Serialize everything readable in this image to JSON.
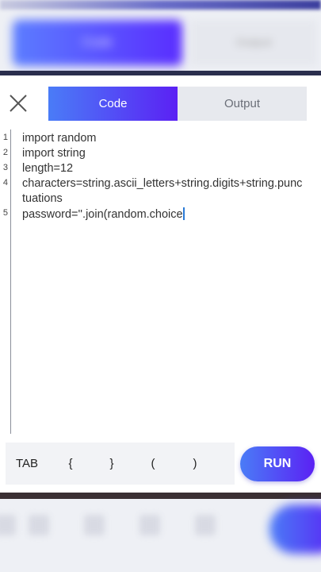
{
  "background": {
    "top_tab_code": "Code",
    "top_tab_output": "Output"
  },
  "header": {
    "close_icon": "close-x-icon",
    "tabs": [
      {
        "label": "Code",
        "active": true
      },
      {
        "label": "Output",
        "active": false
      }
    ]
  },
  "editor": {
    "lines": [
      {
        "num": "1",
        "text": "import random"
      },
      {
        "num": "2",
        "text": "import string"
      },
      {
        "num": "3",
        "text": "length=12"
      },
      {
        "num": "4",
        "text": "characters=string.ascii_letters+string.digits+string.punc"
      },
      {
        "num": "",
        "text": "tuations"
      },
      {
        "num": "5",
        "text": "password=''.join(random.choice"
      }
    ]
  },
  "toolbar": {
    "keys": [
      "TAB",
      "{",
      "}",
      "(",
      ")"
    ],
    "run_label": "RUN"
  },
  "colors": {
    "accent_start": "#4a7cf7",
    "accent_end": "#5b21f4",
    "cursor": "#2a7ad6"
  }
}
